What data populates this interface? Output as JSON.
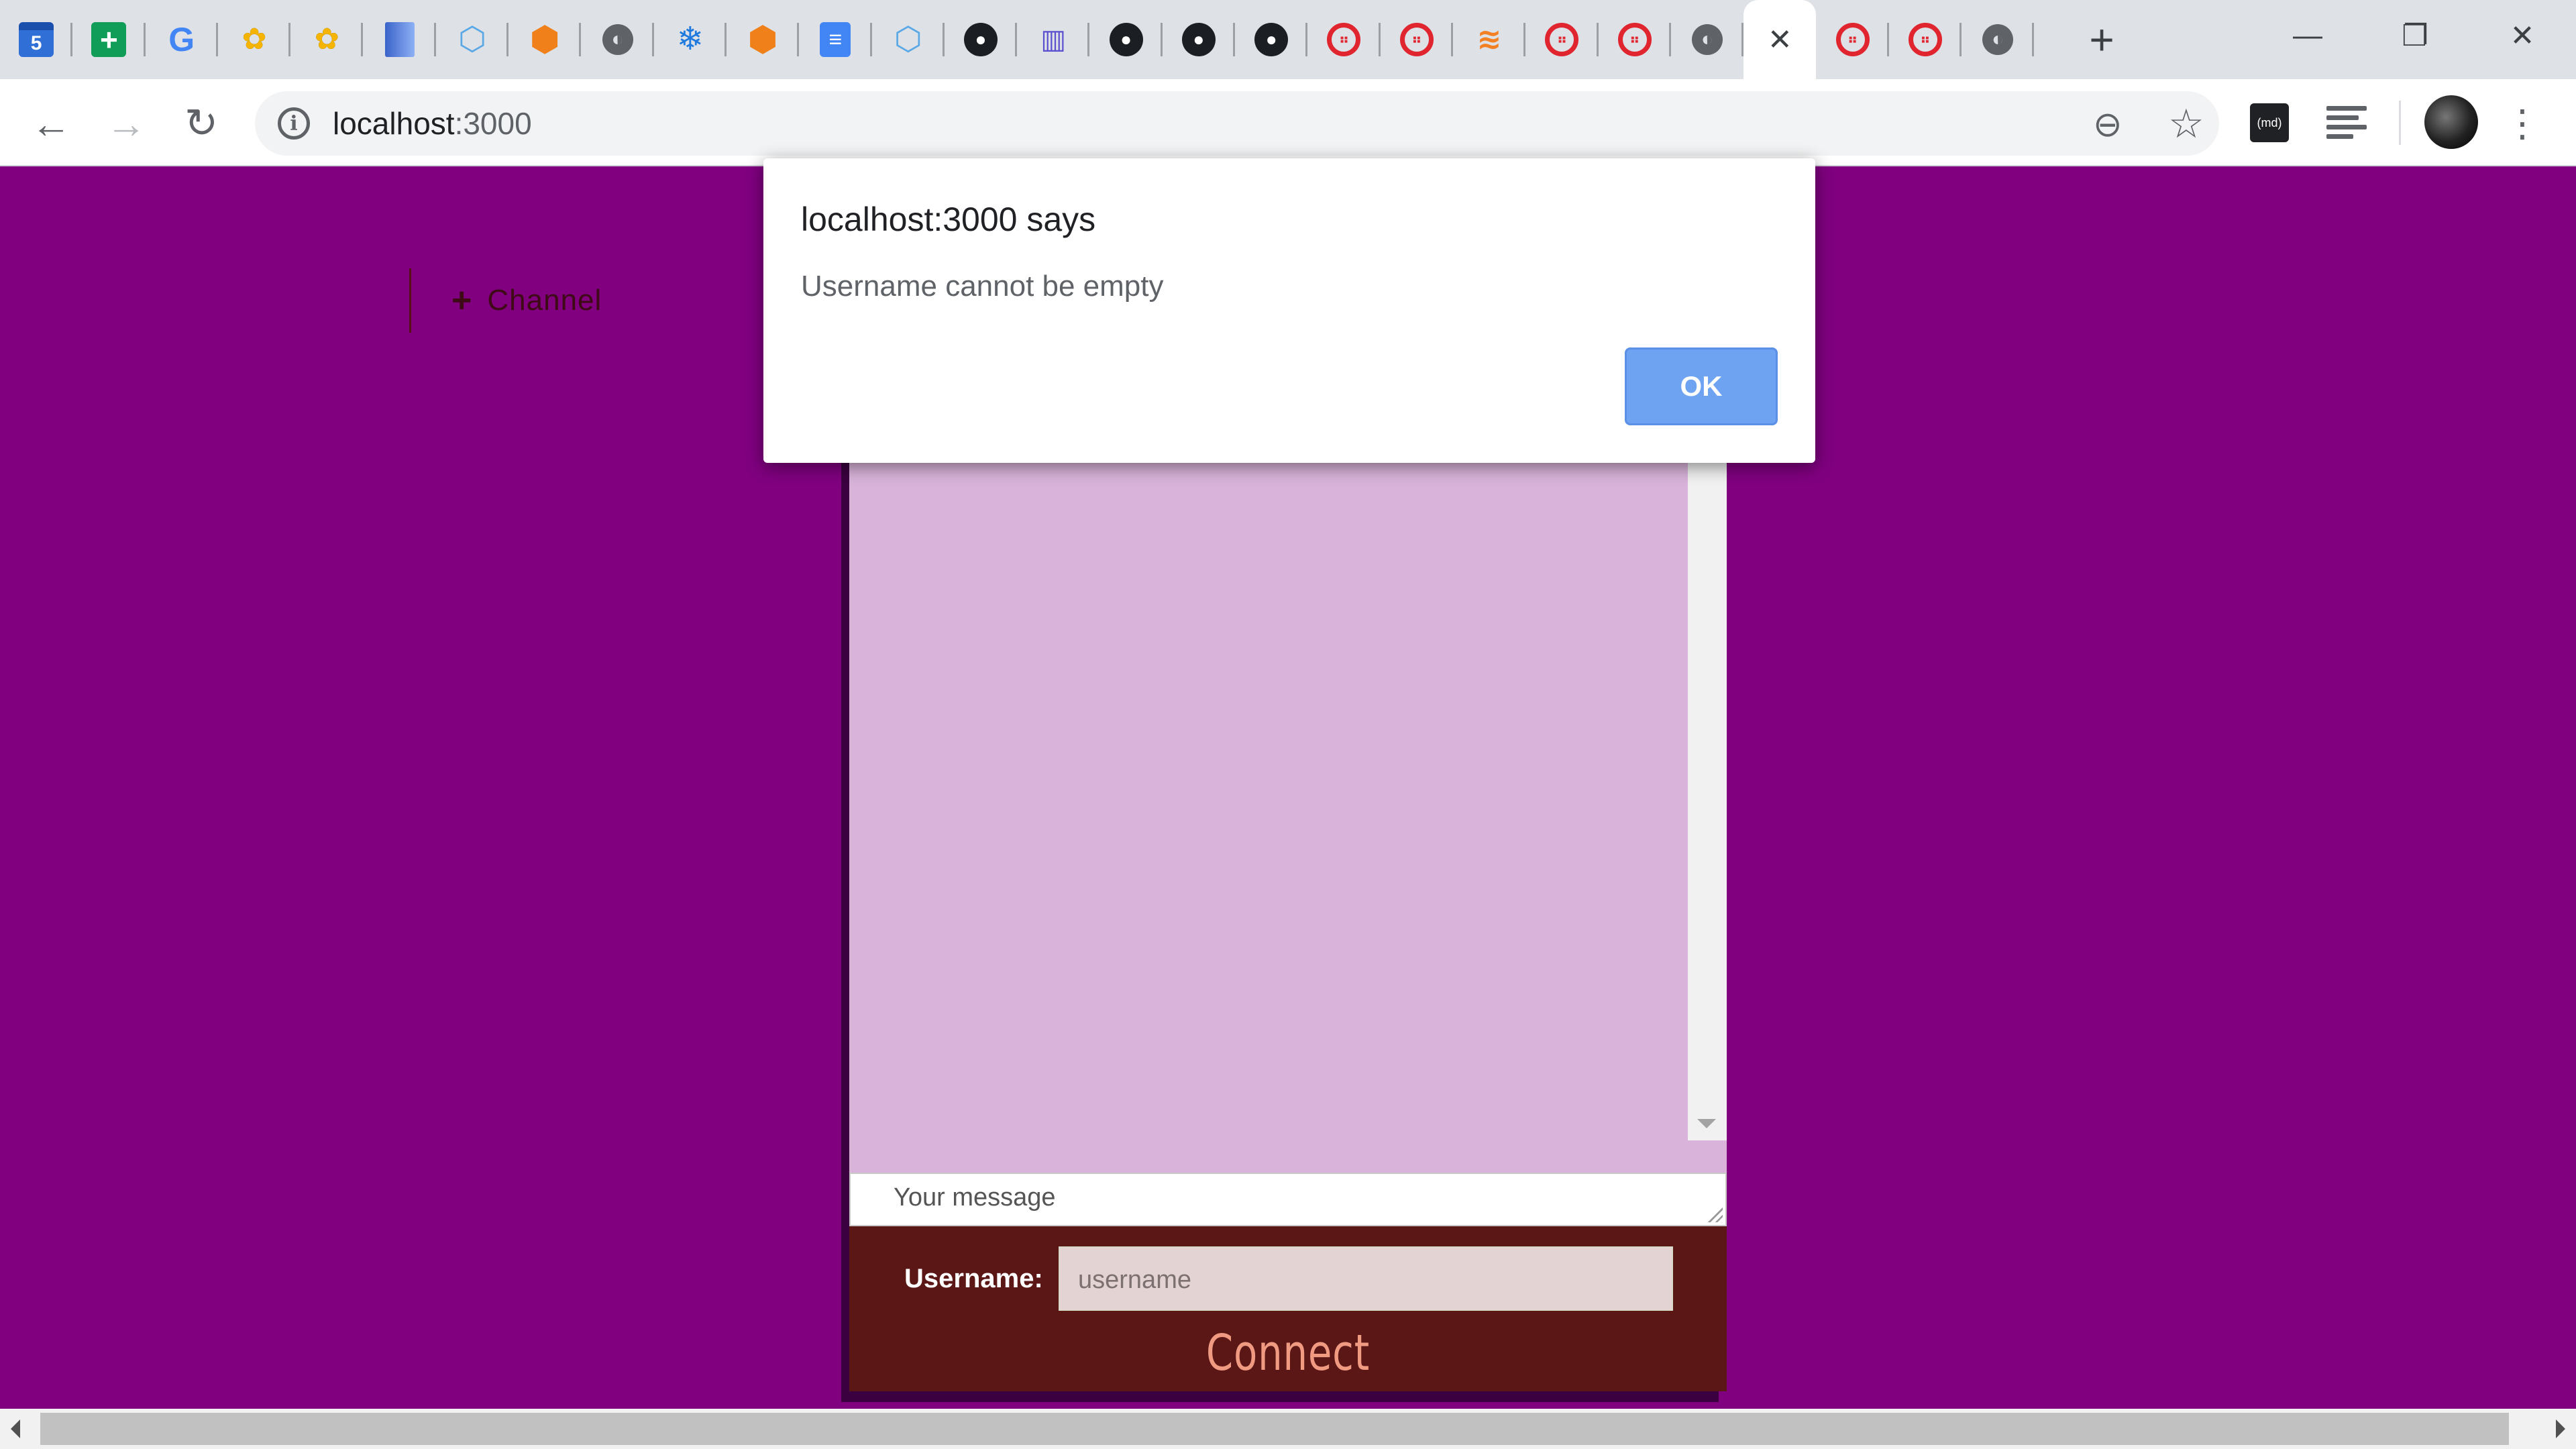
{
  "browser": {
    "tabs": [
      {
        "icon": "google-calendar-icon",
        "glyph": "5"
      },
      {
        "icon": "google-sheets-icon",
        "glyph": "+"
      },
      {
        "icon": "google-icon",
        "glyph": "G"
      },
      {
        "icon": "bee-icon",
        "glyph": "✿"
      },
      {
        "icon": "bee-icon",
        "glyph": "✿"
      },
      {
        "icon": "book-icon",
        "glyph": ""
      },
      {
        "icon": "cube-outline-icon",
        "glyph": "⬡"
      },
      {
        "icon": "orange-cube-icon",
        "glyph": "⬢"
      },
      {
        "icon": "globe-icon",
        "glyph": "◐"
      },
      {
        "icon": "snowflake-icon",
        "glyph": "❄"
      },
      {
        "icon": "orange-cube-icon",
        "glyph": "⬢"
      },
      {
        "icon": "google-docs-icon",
        "glyph": "≡"
      },
      {
        "icon": "cube-outline-icon",
        "glyph": "⬡"
      },
      {
        "icon": "github-icon",
        "glyph": "●"
      },
      {
        "icon": "bar-chart-icon",
        "glyph": "▥"
      },
      {
        "icon": "github-icon",
        "glyph": "●"
      },
      {
        "icon": "github-icon",
        "glyph": "●"
      },
      {
        "icon": "github-icon",
        "glyph": "●"
      },
      {
        "icon": "twilio-icon",
        "glyph": "⠶"
      },
      {
        "icon": "twilio-icon",
        "glyph": "⠶"
      },
      {
        "icon": "stackoverflow-icon",
        "glyph": "≋"
      },
      {
        "icon": "twilio-icon",
        "glyph": "⠶"
      },
      {
        "icon": "twilio-icon",
        "glyph": "⠶"
      },
      {
        "icon": "globe-icon",
        "glyph": "◐"
      },
      {
        "icon": "close-icon",
        "glyph": "✕",
        "active": true
      },
      {
        "icon": "twilio-icon",
        "glyph": "⠶"
      },
      {
        "icon": "twilio-icon",
        "glyph": "⠶"
      },
      {
        "icon": "globe-icon",
        "glyph": "◐"
      }
    ],
    "new_tab_glyph": "+",
    "window": {
      "minimize": "—",
      "restore": "❐",
      "close": "✕"
    },
    "nav": {
      "back": "←",
      "forward": "→",
      "reload": "↻"
    },
    "address": {
      "host": "localhost",
      "port": ":3000",
      "info_glyph": "i"
    },
    "toolbar_icons": {
      "zoom": "⊖",
      "star": "☆",
      "md_extension": "(md)",
      "menu": "⋮"
    }
  },
  "page": {
    "channel_link": {
      "plus": "+",
      "label": "Channel"
    },
    "message_placeholder": "Your message",
    "username_label": "Username:",
    "username_placeholder": "username",
    "connect_label": "Connect"
  },
  "dialog": {
    "title": "localhost:3000 says",
    "message": "Username cannot be empty",
    "ok_label": "OK"
  },
  "colors": {
    "page_background": "#800080",
    "chat_area": "#d9b3da",
    "connect_panel": "#5b1715",
    "connect_text": "#f09a82",
    "ok_button": "#6ea3f2"
  }
}
